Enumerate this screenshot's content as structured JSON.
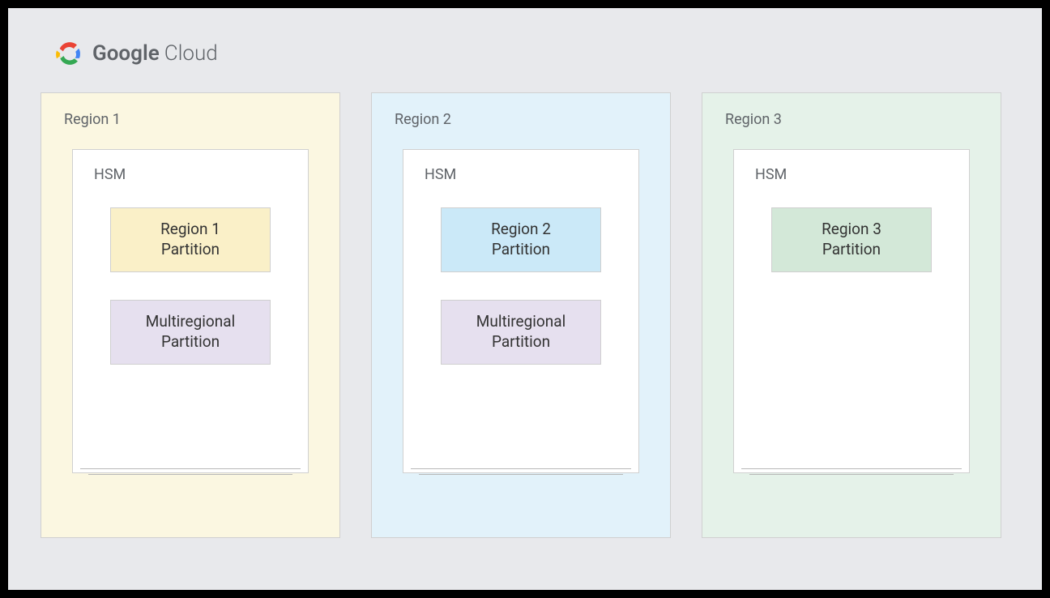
{
  "brand": {
    "google": "Google",
    "cloud": "Cloud"
  },
  "regions": [
    {
      "label": "Region 1",
      "hsm_label": "HSM",
      "partitions": [
        {
          "label": "Region 1\nPartition",
          "color": "yellow"
        },
        {
          "label": "Multiregional\nPartition",
          "color": "purple"
        }
      ]
    },
    {
      "label": "Region 2",
      "hsm_label": "HSM",
      "partitions": [
        {
          "label": "Region 2\nPartition",
          "color": "blue"
        },
        {
          "label": "Multiregional\nPartition",
          "color": "purple"
        }
      ]
    },
    {
      "label": "Region 3",
      "hsm_label": "HSM",
      "partitions": [
        {
          "label": "Region 3\nPartition",
          "color": "green"
        }
      ]
    }
  ]
}
